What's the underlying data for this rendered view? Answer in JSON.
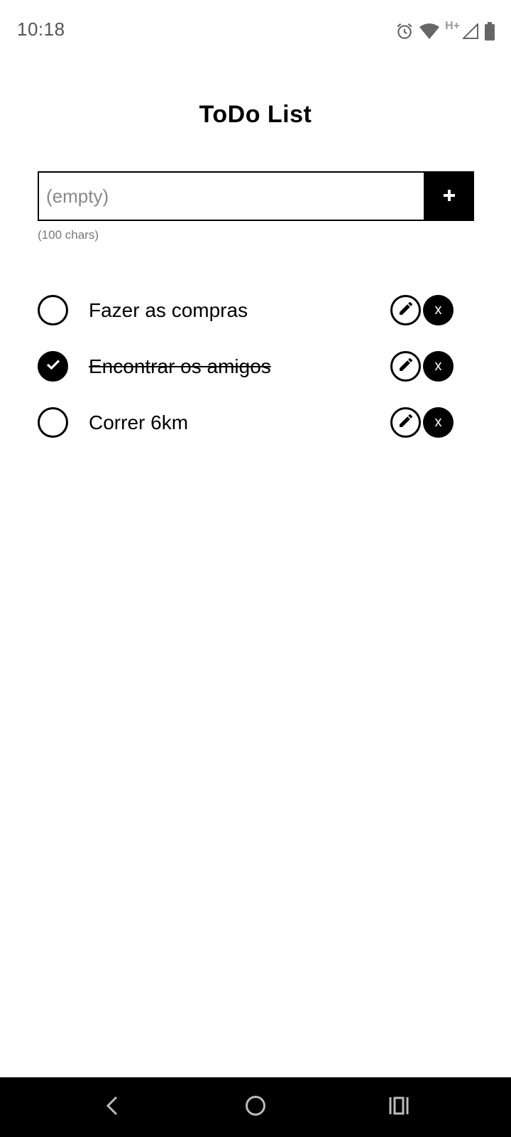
{
  "status_bar": {
    "time": "10:18",
    "network_type": "H+",
    "icons": [
      "alarm-icon",
      "wifi-icon",
      "cell-signal-icon",
      "battery-icon"
    ]
  },
  "header": {
    "title": "ToDo List"
  },
  "new_task": {
    "placeholder": "(empty)",
    "value": "",
    "char_hint": "(100 chars)",
    "add_icon": "plus-icon"
  },
  "tasks": [
    {
      "label": "Fazer as compras",
      "done": false,
      "edit_icon": "pencil-icon",
      "delete_label": "x"
    },
    {
      "label": "Encontrar os amigos",
      "done": true,
      "edit_icon": "pencil-icon",
      "delete_label": "x"
    },
    {
      "label": "Correr 6km",
      "done": false,
      "edit_icon": "pencil-icon",
      "delete_label": "x"
    }
  ],
  "nav_bar": {
    "icons": [
      "back-icon",
      "home-icon",
      "recents-icon"
    ]
  },
  "colors": {
    "background": "#ffffff",
    "accent": "#000000",
    "muted_text": "#777777",
    "nav_bar": "#000000"
  }
}
